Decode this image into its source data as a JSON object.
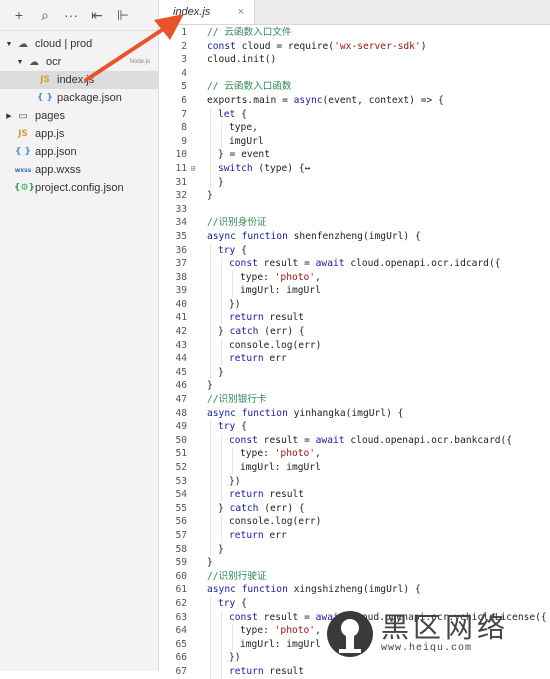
{
  "toolbar": {
    "icons": [
      "plus-icon",
      "search-icon",
      "more-icon",
      "collapse-all-icon",
      "split-icon"
    ],
    "glyphs": [
      "+",
      "⌕",
      "···",
      "⇤",
      "⊩"
    ]
  },
  "tree": [
    {
      "name": "cloud | prod",
      "icon": "cloud-folder",
      "arrow": "▼",
      "depth": 0
    },
    {
      "name": "ocr",
      "icon": "cloud-function-folder",
      "arrow": "▼",
      "depth": 1,
      "tag": "Node.js"
    },
    {
      "name": "index.js",
      "icon": "js",
      "arrow": "",
      "depth": 2,
      "selected": true
    },
    {
      "name": "package.json",
      "icon": "json",
      "arrow": "",
      "depth": 2
    },
    {
      "name": "pages",
      "icon": "folder",
      "arrow": "▶",
      "depth": 0
    },
    {
      "name": "app.js",
      "icon": "js",
      "arrow": "",
      "depth": 0
    },
    {
      "name": "app.json",
      "icon": "json",
      "arrow": "",
      "depth": 0
    },
    {
      "name": "app.wxss",
      "icon": "wxss",
      "arrow": "",
      "depth": 0
    },
    {
      "name": "project.config.json",
      "icon": "config",
      "arrow": "",
      "depth": 0
    }
  ],
  "tab": {
    "label": "index.js",
    "close": "×"
  },
  "code": [
    {
      "n": 1,
      "i": 0,
      "t": [
        [
          "cm",
          "// 云函数入口文件"
        ]
      ]
    },
    {
      "n": 2,
      "i": 0,
      "t": [
        [
          "kw",
          "const"
        ],
        [
          "",
          " cloud = require("
        ],
        [
          "str",
          "'wx-server-sdk'"
        ],
        [
          "",
          ")"
        ]
      ]
    },
    {
      "n": 3,
      "i": 0,
      "t": [
        [
          "",
          "cloud.init()"
        ]
      ]
    },
    {
      "n": 4,
      "i": 0,
      "t": []
    },
    {
      "n": 5,
      "i": 0,
      "t": [
        [
          "cm",
          "// 云函数入口函数"
        ]
      ]
    },
    {
      "n": 6,
      "i": 0,
      "t": [
        [
          "",
          "exports.main = "
        ],
        [
          "kw",
          "async"
        ],
        [
          "",
          "(event, context) => {"
        ]
      ]
    },
    {
      "n": 7,
      "i": 1,
      "t": [
        [
          "kw",
          "let"
        ],
        [
          "",
          " {"
        ]
      ]
    },
    {
      "n": 8,
      "i": 2,
      "t": [
        [
          "",
          "type,"
        ]
      ]
    },
    {
      "n": 9,
      "i": 2,
      "t": [
        [
          "",
          "imgUrl"
        ]
      ]
    },
    {
      "n": 10,
      "i": 1,
      "t": [
        [
          "",
          "} = event"
        ]
      ]
    },
    {
      "n": 11,
      "i": 1,
      "t": [
        [
          "kw",
          "switch"
        ],
        [
          "",
          " (type) {↔"
        ]
      ],
      "fold": "⊞"
    },
    {
      "n": 31,
      "i": 1,
      "t": [
        [
          "",
          "}"
        ]
      ]
    },
    {
      "n": 32,
      "i": 0,
      "t": [
        [
          "",
          "}"
        ]
      ]
    },
    {
      "n": 33,
      "i": 0,
      "t": []
    },
    {
      "n": 34,
      "i": 0,
      "t": [
        [
          "cm",
          "//识别身份证"
        ]
      ]
    },
    {
      "n": 35,
      "i": 0,
      "t": [
        [
          "kw",
          "async function"
        ],
        [
          "",
          " shenfenzheng(imgUrl) {"
        ]
      ]
    },
    {
      "n": 36,
      "i": 1,
      "t": [
        [
          "kw",
          "try"
        ],
        [
          "",
          " {"
        ]
      ]
    },
    {
      "n": 37,
      "i": 2,
      "t": [
        [
          "kw",
          "const"
        ],
        [
          "",
          " result = "
        ],
        [
          "kw",
          "await"
        ],
        [
          "",
          " cloud.openapi.ocr.idcard({"
        ]
      ]
    },
    {
      "n": 38,
      "i": 3,
      "t": [
        [
          "",
          "type: "
        ],
        [
          "str",
          "'photo'"
        ],
        [
          "",
          ","
        ]
      ]
    },
    {
      "n": 39,
      "i": 3,
      "t": [
        [
          "",
          "imgUrl: imgUrl"
        ]
      ]
    },
    {
      "n": 40,
      "i": 2,
      "t": [
        [
          "",
          "})"
        ]
      ]
    },
    {
      "n": 41,
      "i": 2,
      "t": [
        [
          "kw",
          "return"
        ],
        [
          "",
          " result"
        ]
      ]
    },
    {
      "n": 42,
      "i": 1,
      "t": [
        [
          "",
          "} "
        ],
        [
          "kw",
          "catch"
        ],
        [
          "",
          " (err) {"
        ]
      ]
    },
    {
      "n": 43,
      "i": 2,
      "t": [
        [
          "",
          "console.log(err)"
        ]
      ]
    },
    {
      "n": 44,
      "i": 2,
      "t": [
        [
          "kw",
          "return"
        ],
        [
          "",
          " err"
        ]
      ]
    },
    {
      "n": 45,
      "i": 1,
      "t": [
        [
          "",
          "}"
        ]
      ]
    },
    {
      "n": 46,
      "i": 0,
      "t": [
        [
          "",
          "}"
        ]
      ]
    },
    {
      "n": 47,
      "i": 0,
      "t": [
        [
          "cm",
          "//识别银行卡"
        ]
      ]
    },
    {
      "n": 48,
      "i": 0,
      "t": [
        [
          "kw",
          "async function"
        ],
        [
          "",
          " yinhangka(imgUrl) {"
        ]
      ]
    },
    {
      "n": 49,
      "i": 1,
      "t": [
        [
          "kw",
          "try"
        ],
        [
          "",
          " {"
        ]
      ]
    },
    {
      "n": 50,
      "i": 2,
      "t": [
        [
          "kw",
          "const"
        ],
        [
          "",
          " result = "
        ],
        [
          "kw",
          "await"
        ],
        [
          "",
          " cloud.openapi.ocr.bankcard({"
        ]
      ]
    },
    {
      "n": 51,
      "i": 3,
      "t": [
        [
          "",
          "type: "
        ],
        [
          "str",
          "'photo'"
        ],
        [
          "",
          ","
        ]
      ]
    },
    {
      "n": 52,
      "i": 3,
      "t": [
        [
          "",
          "imgUrl: imgUrl"
        ]
      ]
    },
    {
      "n": 53,
      "i": 2,
      "t": [
        [
          "",
          "})"
        ]
      ]
    },
    {
      "n": 54,
      "i": 2,
      "t": [
        [
          "kw",
          "return"
        ],
        [
          "",
          " result"
        ]
      ]
    },
    {
      "n": 55,
      "i": 1,
      "t": [
        [
          "",
          "} "
        ],
        [
          "kw",
          "catch"
        ],
        [
          "",
          " (err) {"
        ]
      ]
    },
    {
      "n": 56,
      "i": 2,
      "t": [
        [
          "",
          "console.log(err)"
        ]
      ]
    },
    {
      "n": 57,
      "i": 2,
      "t": [
        [
          "kw",
          "return"
        ],
        [
          "",
          " err"
        ]
      ]
    },
    {
      "n": 58,
      "i": 1,
      "t": [
        [
          "",
          "}"
        ]
      ]
    },
    {
      "n": 59,
      "i": 0,
      "t": [
        [
          "",
          "}"
        ]
      ]
    },
    {
      "n": 60,
      "i": 0,
      "t": [
        [
          "cm",
          "//识别行驶证"
        ]
      ]
    },
    {
      "n": 61,
      "i": 0,
      "t": [
        [
          "kw",
          "async function"
        ],
        [
          "",
          " xingshizheng(imgUrl) {"
        ]
      ]
    },
    {
      "n": 62,
      "i": 1,
      "t": [
        [
          "kw",
          "try"
        ],
        [
          "",
          " {"
        ]
      ]
    },
    {
      "n": 63,
      "i": 2,
      "t": [
        [
          "kw",
          "const"
        ],
        [
          "",
          " result = "
        ],
        [
          "kw",
          "await"
        ],
        [
          "",
          " cloud.openapi.ocr.vehicleLicense({"
        ]
      ]
    },
    {
      "n": 64,
      "i": 3,
      "t": [
        [
          "",
          "type: "
        ],
        [
          "str",
          "'photo'"
        ],
        [
          "",
          ","
        ]
      ]
    },
    {
      "n": 65,
      "i": 3,
      "t": [
        [
          "",
          "imgUrl: imgUrl"
        ]
      ]
    },
    {
      "n": 66,
      "i": 2,
      "t": [
        [
          "",
          "})"
        ]
      ]
    },
    {
      "n": 67,
      "i": 2,
      "t": [
        [
          "kw",
          "return"
        ],
        [
          "",
          " result"
        ]
      ]
    }
  ],
  "watermark": {
    "main": "黑区网络",
    "url": "www.heiqu.com"
  },
  "colors": {
    "arrow": "#e8532b",
    "keyword": "#1a1aa6",
    "string": "#a31515",
    "comment": "#2e8b57"
  }
}
